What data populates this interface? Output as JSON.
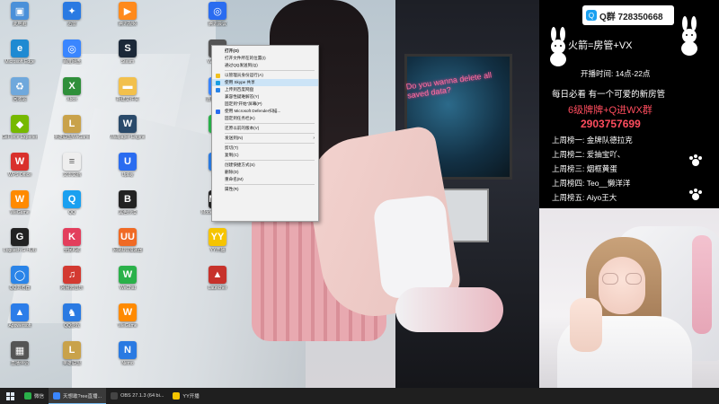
{
  "desktop": {
    "icons": [
      {
        "label": "此电脑",
        "color": "#4a90d9",
        "glyph": "▣"
      },
      {
        "label": "Microsoft Edge",
        "color": "#1f8ad2",
        "glyph": "e"
      },
      {
        "label": "回收站",
        "color": "#6fa8dc",
        "glyph": "♻"
      },
      {
        "label": "GeForce Experience",
        "color": "#76b900",
        "glyph": "◆"
      },
      {
        "label": "WPS Office",
        "color": "#d9302c",
        "glyph": "W"
      },
      {
        "label": "WeGame",
        "color": "#ff8a00",
        "glyph": "W"
      },
      {
        "label": "Logitech G HUB",
        "color": "#222222",
        "glyph": "G"
      },
      {
        "label": "QQ浏览器",
        "color": "#2a84e8",
        "glyph": "◯"
      },
      {
        "label": "Apowersoft",
        "color": "#2b7de9",
        "glyph": "▲"
      },
      {
        "label": "直播伴侣",
        "color": "#555555",
        "glyph": "▦"
      },
      {
        "label": "迅雷",
        "color": "#2a7ae2",
        "glyph": "✦"
      },
      {
        "label": "百度网盘",
        "color": "#3a86ff",
        "glyph": "◎"
      },
      {
        "label": "Xbox",
        "color": "#2f8f3a",
        "glyph": "X"
      },
      {
        "label": "英雄联盟WeGame版",
        "color": "#c9a24a",
        "glyph": "L"
      },
      {
        "label": "文本文档",
        "color": "#eeeeee",
        "glyph": "≡"
      },
      {
        "label": "QQ",
        "color": "#1aa0f0",
        "glyph": "Q"
      },
      {
        "label": "全民K歌",
        "color": "#e33e5c",
        "glyph": "K"
      },
      {
        "label": "网易云音乐",
        "color": "#d33a31",
        "glyph": "♫"
      },
      {
        "label": "QQ游戏",
        "color": "#2a7ae2",
        "glyph": "♞"
      },
      {
        "label": "英雄联盟",
        "color": "#c9a24a",
        "glyph": "L"
      },
      {
        "label": "腾讯视频",
        "color": "#ff8a1c",
        "glyph": "▶"
      },
      {
        "label": "Steam",
        "color": "#1b2838",
        "glyph": "S"
      },
      {
        "label": "新建文件夹",
        "color": "#f2c04c",
        "glyph": "▬"
      },
      {
        "label": "Wallpaper Engine",
        "color": "#2a4a6a",
        "glyph": "W"
      },
      {
        "label": "Uplay",
        "color": "#2a6cf0",
        "glyph": "U"
      },
      {
        "label": "黑色沙漠",
        "color": "#222222",
        "glyph": "B"
      },
      {
        "label": "网易UU加速器",
        "color": "#f06a24",
        "glyph": "UU"
      },
      {
        "label": "WeChat",
        "color": "#2ab14a",
        "glyph": "W"
      },
      {
        "label": "WeGame",
        "color": "#ff8a00",
        "glyph": "W"
      },
      {
        "label": "Nemo",
        "color": "#2a7ae2",
        "glyph": "N"
      },
      {
        "label": "腾讯会议",
        "color": "#2a6cf0",
        "glyph": "◎"
      },
      {
        "label": "Warframe",
        "color": "#555555",
        "glyph": "◇"
      },
      {
        "label": "蓝叠模拟器",
        "color": "#3a86ff",
        "glyph": "◐"
      },
      {
        "label": "微信",
        "color": "#2ab14a",
        "glyph": "◉"
      },
      {
        "label": "Kook",
        "color": "#2a7ae2",
        "glyph": "K"
      },
      {
        "label": "Modern Warfare",
        "color": "#222222",
        "glyph": "MW"
      },
      {
        "label": "YY开播",
        "color": "#f5c400",
        "glyph": "YY"
      },
      {
        "label": "Launcher",
        "color": "#c7322b",
        "glyph": "▲"
      }
    ]
  },
  "context_menu": {
    "items": [
      {
        "label": "打开(O)",
        "icon": "",
        "bold": true
      },
      {
        "label": "打开文件所在的位置(I)",
        "icon": ""
      },
      {
        "label": "通过QQ发送到(Q)",
        "icon": ""
      },
      {
        "sep": true
      },
      {
        "label": "以管理员身份运行(A)",
        "icon": "shield-icon",
        "iconColor": "#f0c020"
      },
      {
        "label": "使用 Skype 共享",
        "icon": "skype-icon",
        "iconColor": "#1a9de0",
        "highlight": true
      },
      {
        "label": "上传到百度网盘",
        "icon": "cloud-icon",
        "iconColor": "#2a84e8"
      },
      {
        "label": "兼容性疑难解答(Y)",
        "icon": ""
      },
      {
        "label": "固定到\"开始\"屏幕(P)",
        "icon": ""
      },
      {
        "label": "使用 Microsoft Defender扫描...",
        "icon": "defender-icon",
        "iconColor": "#2a6cf0"
      },
      {
        "label": "固定到任务栏(K)",
        "icon": ""
      },
      {
        "sep": true
      },
      {
        "label": "还原以前的版本(V)",
        "icon": ""
      },
      {
        "sep": true
      },
      {
        "label": "发送到(N)",
        "icon": "",
        "submenu": true
      },
      {
        "sep": true
      },
      {
        "label": "剪切(T)",
        "icon": ""
      },
      {
        "label": "复制(C)",
        "icon": ""
      },
      {
        "sep": true
      },
      {
        "label": "创建快捷方式(S)",
        "icon": ""
      },
      {
        "label": "删除(D)",
        "icon": ""
      },
      {
        "label": "重命名(M)",
        "icon": ""
      },
      {
        "sep": true
      },
      {
        "label": "属性(R)",
        "icon": ""
      }
    ]
  },
  "taskbar": {
    "items": [
      {
        "label": "微信",
        "color": "#2ab14a",
        "active": false
      },
      {
        "label": "天想敢?ree直播...",
        "color": "#3a86ff",
        "active": true
      },
      {
        "label": "OBS 27.1.3 (64 bi...",
        "color": "#444444",
        "active": false
      },
      {
        "label": "YY开播",
        "color": "#f5c400",
        "active": false
      }
    ]
  },
  "overlay": {
    "qq_group": "Q群 728350668",
    "title": "火箭=房管+VX",
    "stream_time": "开播时间: 14点-22点",
    "daily": "每日必看 有一个可爱的新房管",
    "level_rule": "6级牌牌+Q进WX群",
    "number": "2903757699",
    "ranks": [
      "上周榜一: 金牌队德拉克",
      "上周榜二: 爱抽宝吖、",
      "上周榜三: 烟框黄蛋",
      "上周榜四: Teo__懒洋洋",
      "上周榜五: Aiyo王大"
    ]
  },
  "neon": "Do you wanna delete all saved data?"
}
